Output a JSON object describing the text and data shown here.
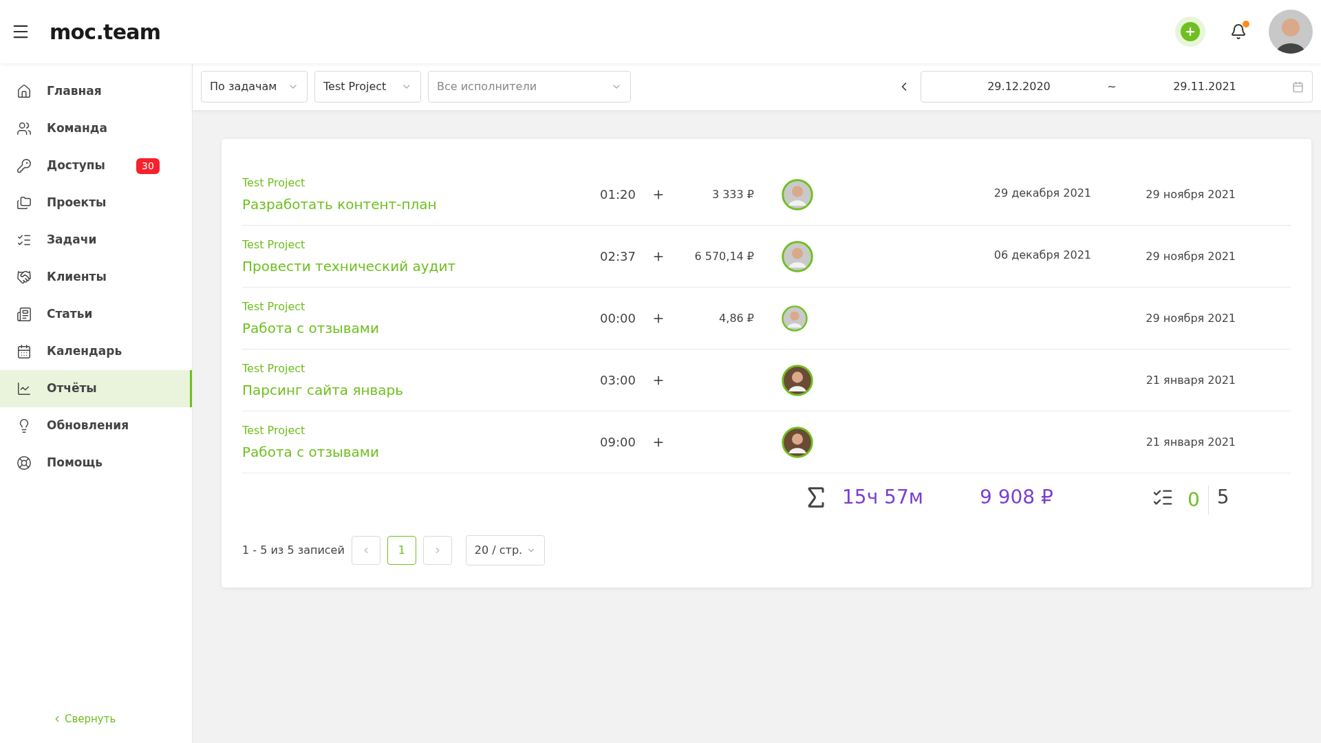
{
  "header": {
    "logo": "moc.team"
  },
  "sidebar": {
    "items": [
      {
        "label": "Главная",
        "selected": false
      },
      {
        "label": "Команда",
        "selected": false
      },
      {
        "label": "Доступы",
        "selected": false,
        "badge": "30"
      },
      {
        "label": "Проекты",
        "selected": false
      },
      {
        "label": "Задачи",
        "selected": false
      },
      {
        "label": "Клиенты",
        "selected": false
      },
      {
        "label": "Статьи",
        "selected": false
      },
      {
        "label": "Календарь",
        "selected": false
      },
      {
        "label": "Отчёты",
        "selected": true
      },
      {
        "label": "Обновления",
        "selected": false
      },
      {
        "label": "Помощь",
        "selected": false
      }
    ],
    "collapse": "Свернуть"
  },
  "filters": {
    "group_by": "По задачам",
    "project": "Test Project",
    "assignee": {
      "placeholder": "Все исполнители"
    },
    "date_from": "29.12.2020",
    "date_separator": "~",
    "date_to": "29.11.2021"
  },
  "rows": [
    {
      "project": "Test Project",
      "task": "Разработать контент-план",
      "time": "01:20",
      "amount": "3 333 ₽",
      "date_1": "29 декабря 2021",
      "date_2": "29 ноября 2021"
    },
    {
      "project": "Test Project",
      "task": "Провести технический аудит",
      "time": "02:37",
      "amount": "6 570,14 ₽",
      "date_1": "06 декабря 2021",
      "date_2": "29 ноября 2021"
    },
    {
      "project": "Test Project",
      "task": "Работа с отзывами",
      "time": "00:00",
      "amount": "4,86 ₽",
      "date_2": "29 ноября 2021"
    },
    {
      "project": "Test Project",
      "task": "Парсинг сайта январь",
      "time": "03:00",
      "date_2": "21 января 2021"
    },
    {
      "project": "Test Project",
      "task": "Работа с отзывами",
      "time": "09:00",
      "date_2": "21 января 2021"
    }
  ],
  "totals": {
    "time": "15ч 57м",
    "amount": "9 908 ₽",
    "done": "0",
    "total": "5"
  },
  "pagination": {
    "summary": "1 - 5 из 5 записей",
    "pages": [
      {
        "label": "1",
        "selected": true
      }
    ],
    "page_size": "20 / стр."
  }
}
